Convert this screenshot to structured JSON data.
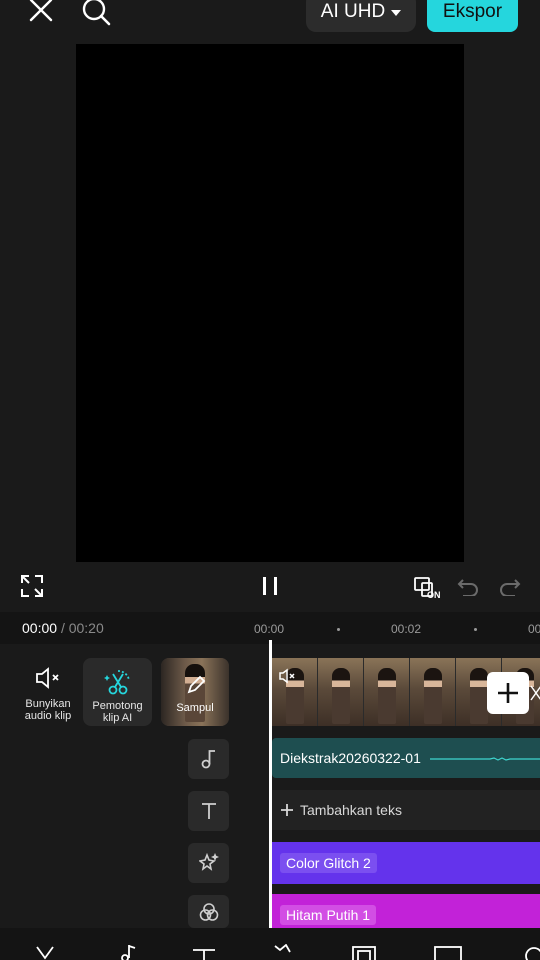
{
  "topbar": {
    "close_icon": "close-icon",
    "search_icon": "search-icon",
    "resolution_label": "AI UHD",
    "export_label": "Ekspor"
  },
  "controls": {
    "fullscreen_icon": "fullscreen-icon",
    "pause_icon": "pause-icon",
    "dual_screen_badge": "ON",
    "undo_icon": "undo-icon",
    "redo_icon": "redo-icon"
  },
  "time": {
    "current": "00:00",
    "separator": "/",
    "total": "00:20",
    "ruler": [
      "00:00",
      "00:02",
      "00"
    ]
  },
  "side_tools": {
    "audio_label_line1": "Bunyikan",
    "audio_label_line2": "audio klip",
    "ai_cut_line1": "Pemotong",
    "ai_cut_line2": "klip AI",
    "cover_label": "Sampul"
  },
  "tracks": {
    "audio_name": "Diekstrak20260322-01",
    "add_text": "Tambahkan teks",
    "effect1": "Color Glitch 2",
    "effect2": "Hitam Putih 1"
  },
  "colors": {
    "accent": "#25d6dd",
    "audio_track": "#1e4e50",
    "effect1": "#6433ec",
    "effect2": "#c222d8"
  },
  "bottom_icons": [
    "cut-icon",
    "music-icon",
    "text-icon",
    "sticker-icon",
    "overlay-icon",
    "aspect-icon",
    "more-icon"
  ]
}
